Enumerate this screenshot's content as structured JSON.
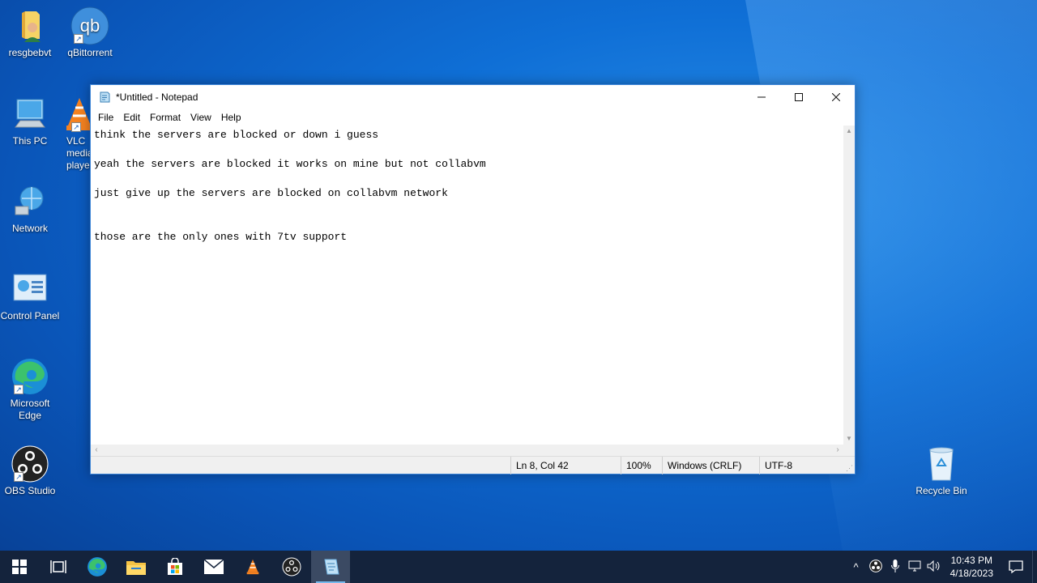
{
  "desktop": {
    "icons": [
      {
        "label": "resgbebvt",
        "icon": "user-folder-icon"
      },
      {
        "label": "qBittorrent",
        "icon": "qbittorrent-icon"
      },
      {
        "label": "This PC",
        "icon": "computer-icon"
      },
      {
        "label": "VLC media player",
        "icon": "vlc-icon"
      },
      {
        "label": "Network",
        "icon": "network-icon"
      },
      {
        "label": "Control Panel",
        "icon": "control-panel-icon"
      },
      {
        "label": "Microsoft Edge",
        "icon": "edge-icon"
      },
      {
        "label": "OBS Studio",
        "icon": "obs-icon"
      },
      {
        "label": "Recycle Bin",
        "icon": "recycle-bin-icon"
      }
    ]
  },
  "notepad": {
    "title": "*Untitled - Notepad",
    "menu": [
      "File",
      "Edit",
      "Format",
      "View",
      "Help"
    ],
    "content": "think the servers are blocked or down i guess\n\nyeah the servers are blocked it works on mine but not collabvm\n\njust give up the servers are blocked on collabvm network\n\n\nthose are the only ones with 7tv support",
    "status": {
      "position": "Ln 8, Col 42",
      "zoom": "100%",
      "line_ending": "Windows (CRLF)",
      "encoding": "UTF-8"
    }
  },
  "taskbar": {
    "apps": [
      "start-icon",
      "task-view-icon",
      "edge-icon",
      "file-explorer-icon",
      "store-icon",
      "mail-icon",
      "vlc-icon",
      "obs-icon",
      "notepad-icon"
    ],
    "clock": {
      "time": "10:43 PM",
      "date": "4/18/2023"
    }
  },
  "colors": {
    "window_border": "#3b83d6",
    "taskbar": "#14233c",
    "accent": "#76b9ed"
  }
}
